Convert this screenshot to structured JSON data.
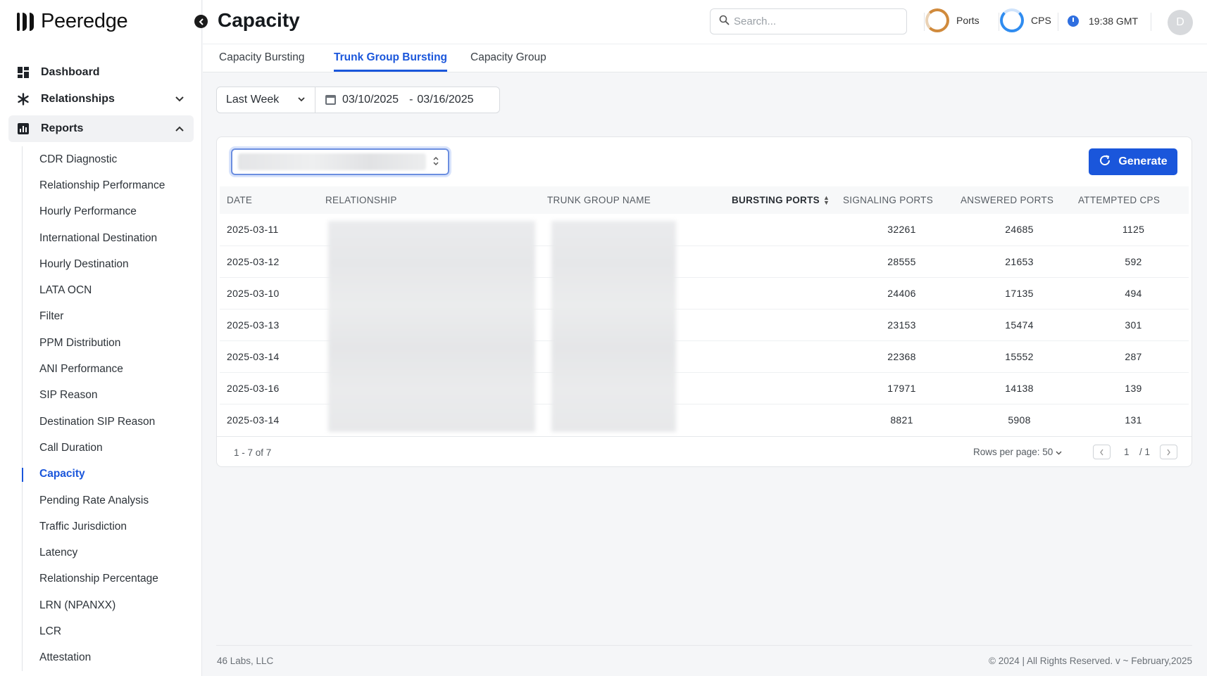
{
  "app": {
    "name": "Peeredge"
  },
  "sidebar": {
    "top_items": [
      {
        "label": "Dashboard",
        "icon": "dashboard-icon"
      },
      {
        "label": "Relationships",
        "icon": "asterisk-icon"
      },
      {
        "label": "Reports",
        "icon": "reports-icon"
      }
    ],
    "report_items": [
      "CDR Diagnostic",
      "Relationship Performance",
      "Hourly Performance",
      "International Destination",
      "Hourly Destination",
      "LATA OCN",
      "Filter",
      "PPM Distribution",
      "ANI Performance",
      "SIP Reason",
      "Destination SIP Reason",
      "Call Duration",
      "Capacity",
      "Pending Rate Analysis",
      "Traffic Jurisdiction",
      "Latency",
      "Relationship Percentage",
      "LRN (NPANXX)",
      "LCR",
      "Attestation"
    ],
    "active_item": "Capacity"
  },
  "header": {
    "title": "Capacity",
    "search_placeholder": "Search...",
    "ports_label": "Ports",
    "cps_label": "CPS",
    "time": "19:38 GMT",
    "avatar_initial": "D"
  },
  "tabs": [
    "Capacity Bursting",
    "Trunk Group Bursting",
    "Capacity Group"
  ],
  "active_tab": "Trunk Group Bursting",
  "filter": {
    "period": "Last Week",
    "date_from": "03/10/2025",
    "date_sep": "-",
    "date_to": "03/16/2025"
  },
  "generate_label": "Generate",
  "table": {
    "columns": [
      "DATE",
      "RELATIONSHIP",
      "TRUNK GROUP NAME",
      "BURSTING PORTS",
      "SIGNALING PORTS",
      "ANSWERED PORTS",
      "ATTEMPTED CPS"
    ],
    "rows": [
      {
        "date": "2025-03-11",
        "signaling": "32261",
        "answered": "24685",
        "cps": "1125"
      },
      {
        "date": "2025-03-12",
        "signaling": "28555",
        "answered": "21653",
        "cps": "592"
      },
      {
        "date": "2025-03-10",
        "signaling": "24406",
        "answered": "17135",
        "cps": "494"
      },
      {
        "date": "2025-03-13",
        "signaling": "23153",
        "answered": "15474",
        "cps": "301"
      },
      {
        "date": "2025-03-14",
        "signaling": "22368",
        "answered": "15552",
        "cps": "287"
      },
      {
        "date": "2025-03-16",
        "signaling": "17971",
        "answered": "14138",
        "cps": "139"
      },
      {
        "date": "2025-03-14",
        "signaling": "8821",
        "answered": "5908",
        "cps": "131"
      }
    ]
  },
  "pagination": {
    "range": "1 - 7 of 7",
    "rows_per_page_label": "Rows per page: 50",
    "current_page": "1",
    "total_pages": "/ 1"
  },
  "footer": {
    "company": "46 Labs, LLC",
    "copyright": "© 2024 | All Rights Reserved. v ~ February,2025"
  }
}
